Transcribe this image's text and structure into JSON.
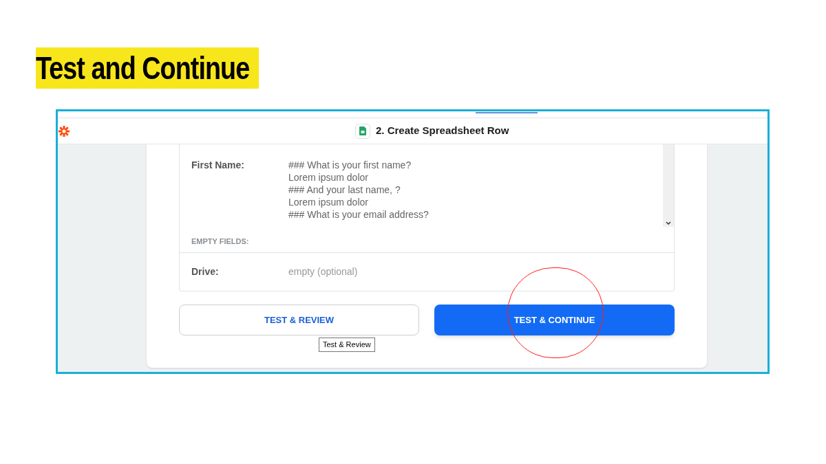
{
  "title": "Test and Continue",
  "step": {
    "title": "2. Create Spreadsheet Row"
  },
  "fields": [
    {
      "label": "First Name:",
      "lines": [
        "### What is your first name?",
        "Lorem ipsum dolor",
        "### And your last name, ?",
        "Lorem ipsum dolor",
        "### What is your email address?"
      ]
    }
  ],
  "empty_section": {
    "heading": "EMPTY FIELDS:",
    "fields": [
      {
        "label": "Drive:",
        "value": "empty (optional)"
      }
    ]
  },
  "buttons": [
    {
      "label": "TEST & REVIEW",
      "kind": "secondary"
    },
    {
      "label": "TEST & CONTINUE",
      "kind": "primary"
    }
  ],
  "tooltip": "Test & Review"
}
